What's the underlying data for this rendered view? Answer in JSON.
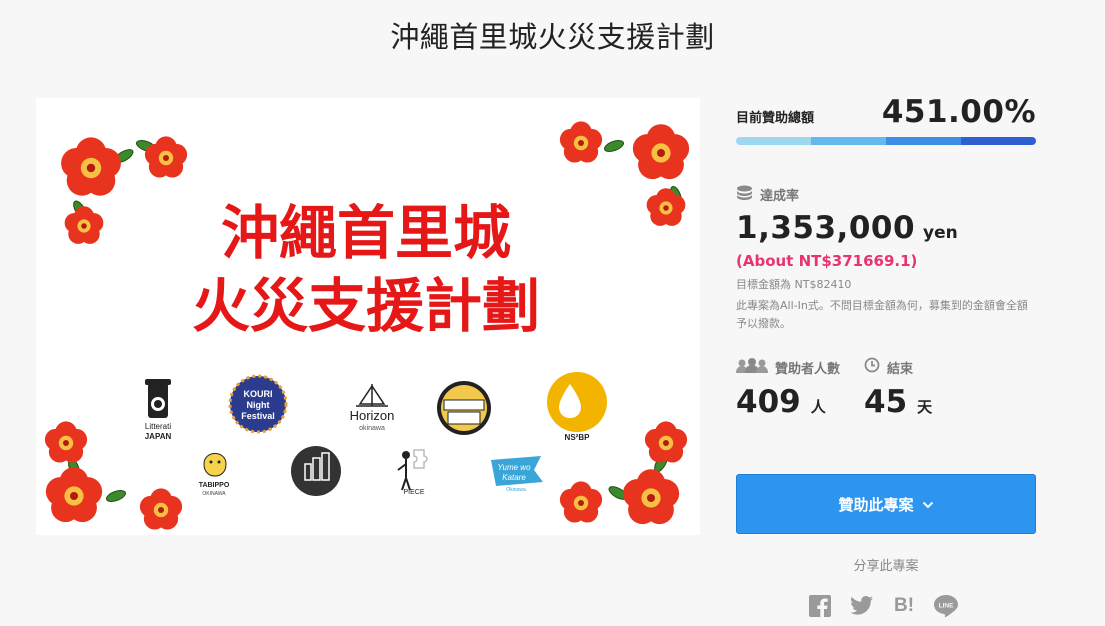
{
  "page": {
    "title": "沖繩首里城火災支援計劃"
  },
  "hero": {
    "line1": "沖繩首里城",
    "line2": "火災支援計劃",
    "logos": {
      "litterati_1": "Litterati",
      "litterati_2": "JAPAN",
      "kouri_1": "KOURI",
      "kouri_2": "Night",
      "kouri_3": "Festival",
      "horizon_1": "Horizon",
      "horizon_2": "okinawa",
      "nsbp": "NS²BP",
      "tabippo_1": "TABIPPO",
      "tabippo_2": "OKINAWA",
      "piece": "PIECE",
      "yume_1": "Yume wo",
      "yume_2": "Katare",
      "yume_3": "Okinawa"
    }
  },
  "funding": {
    "total_label": "目前贊助總額",
    "percent": "451.00%",
    "progress_colors": [
      "#9ed7f0",
      "#66b8ee",
      "#3d8fe4",
      "#2f5fd0"
    ],
    "achieved_label": "達成率",
    "amount": "1,353,000",
    "amount_unit": "yen",
    "about": "(About NT$371669.1)",
    "goal": "目標金額為 NT$82410",
    "note": "此專案為All-In式。不問目標金額為何，募集到的金額會全額予以撥款。"
  },
  "stats": {
    "backers_label": "贊助者人數",
    "backers": "409",
    "backers_unit": "人",
    "end_label": "結束",
    "days": "45",
    "days_unit": "天"
  },
  "cta": {
    "label": "贊助此專案"
  },
  "share": {
    "label": "分享此專案",
    "hatena": "B!",
    "line": "LINE"
  }
}
